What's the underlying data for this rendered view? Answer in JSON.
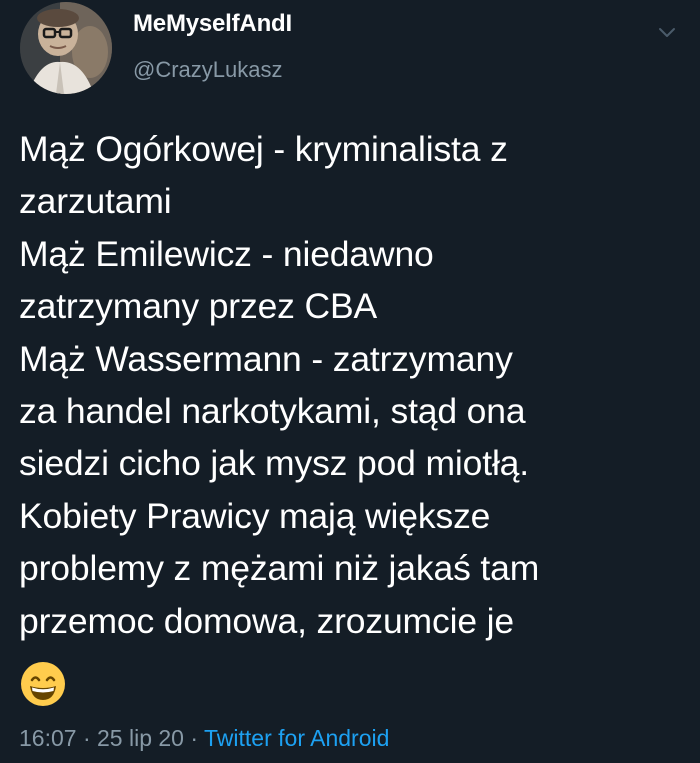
{
  "author": {
    "display_name": "MeMyselfAndI",
    "handle": "@CrazyLukasz"
  },
  "tweet": {
    "lines": [
      "Mąż Ogórkowej - kryminalista z",
      "zarzutami",
      "Mąż Emilewicz - niedawno",
      "zatrzymany przez CBA",
      "Mąż Wassermann - zatrzymany",
      "za handel narkotykami, stąd ona",
      "siedzi cicho jak mysz pod miotłą.",
      "Kobiety Prawicy mają większe",
      "problemy z mężami niż jakaś tam",
      "przemoc domowa, zrozumcie je"
    ],
    "emoji": "grinning-face-with-smiling-eyes"
  },
  "meta": {
    "time": "16:07",
    "separator": "·",
    "date": "25 lip 20",
    "source": "Twitter for Android"
  },
  "colors": {
    "background": "#141d26",
    "text": "#ffffff",
    "secondary_text": "#8899a6",
    "link": "#1da1f2"
  },
  "icons": {
    "menu": "chevron-down-icon"
  }
}
